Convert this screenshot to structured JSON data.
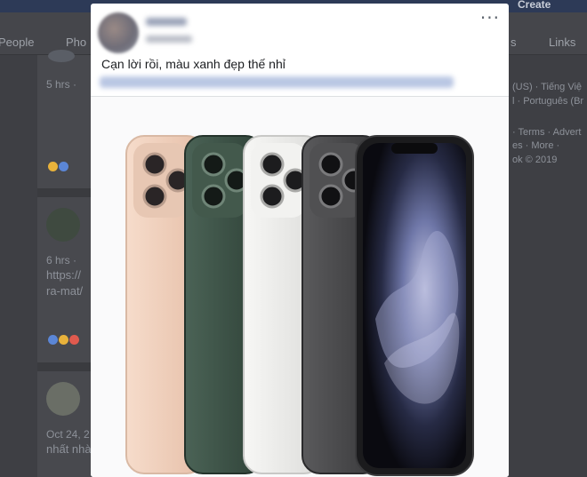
{
  "topbar": {
    "create_label": "Create"
  },
  "tabs": [
    "People",
    "Pho",
    "s",
    "Links"
  ],
  "background_posts": [
    {
      "time": "5 hrs ·"
    },
    {
      "time": "6 hrs ·",
      "line1": "https://",
      "line2": "ra-mat/"
    },
    {
      "time": "Oct 24, 2",
      "line1": "nhất nhà"
    }
  ],
  "right_sidebar": [
    "(US) · Tiếng Việ",
    "l · Português (Br",
    "· Terms · Advert",
    "es · More ·",
    "ok © 2019"
  ],
  "post": {
    "text": "Cạn lời rồi, màu xanh đẹp thế nhỉ",
    "more_icon": "···",
    "phones": [
      {
        "finish": "gold",
        "color": "#f0d3c0"
      },
      {
        "finish": "midnight-green",
        "color": "#3c5246"
      },
      {
        "finish": "silver",
        "color": "#ececea"
      },
      {
        "finish": "space-gray",
        "color": "#4a4a4c"
      },
      {
        "finish": "front-display",
        "color": "#0b0b0d"
      }
    ]
  }
}
